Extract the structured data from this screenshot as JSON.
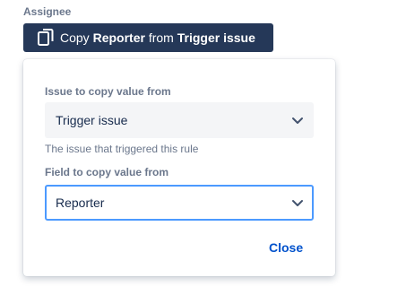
{
  "assignee_label": "Assignee",
  "copy_button": {
    "prefix": "Copy ",
    "field": "Reporter",
    "middle": " from ",
    "source": "Trigger issue",
    "icon": "copy-icon"
  },
  "popup": {
    "issue_label": "Issue to copy value from",
    "issue_value": "Trigger issue",
    "issue_helper": "The issue that triggered this rule",
    "field_label": "Field to copy value from",
    "field_value": "Reporter",
    "close_label": "Close"
  },
  "colors": {
    "button_bg": "#253858",
    "focus_border": "#4c9aff",
    "link": "#0052cc",
    "label": "#6b778c"
  }
}
